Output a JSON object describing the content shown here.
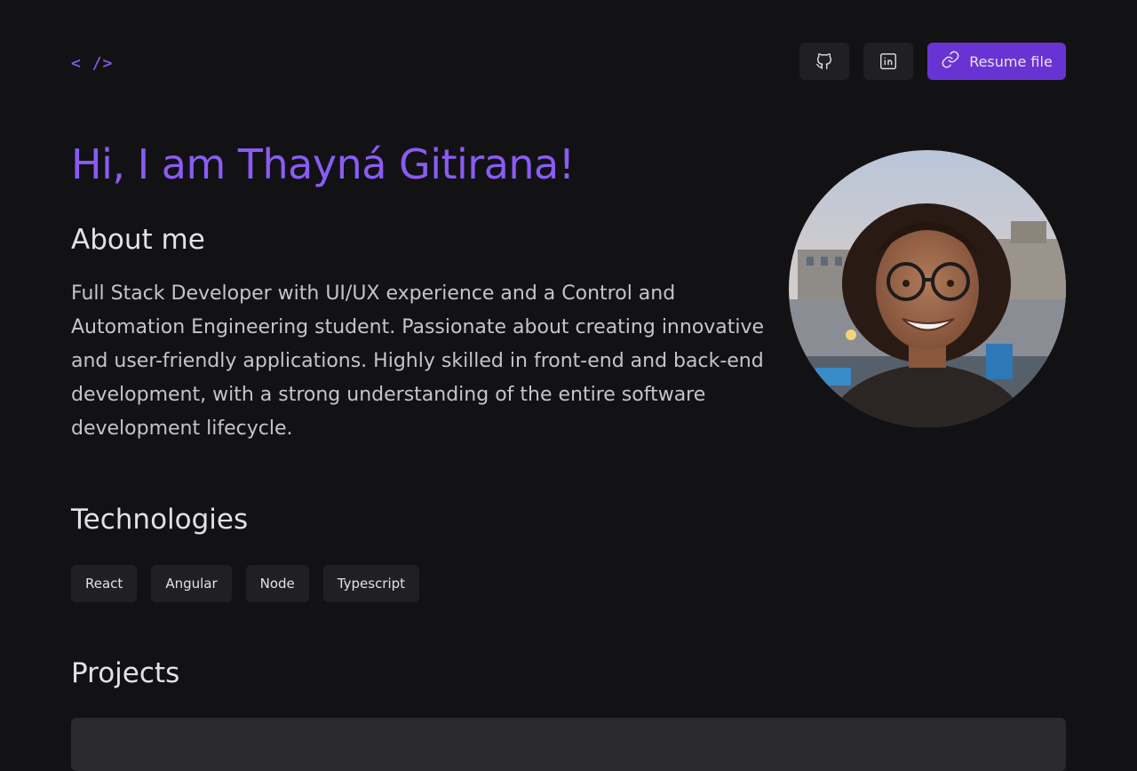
{
  "header": {
    "logo": "< />",
    "github_icon": "github-icon",
    "linkedin_icon": "linkedin-icon",
    "resume_icon": "link-icon",
    "resume_label": "Resume file"
  },
  "hero": {
    "greeting": "Hi, I am Thayná Gitirana!",
    "about_title": "About me",
    "about_text": "Full Stack Developer with UI/UX experience and a Control and Automation Engineering student. Passionate about creating innovative and user-friendly applications. Highly skilled in front-end and back-end development, with a strong understanding of the entire software development lifecycle."
  },
  "technologies": {
    "title": "Technologies",
    "items": [
      "React",
      "Angular",
      "Node",
      "Typescript"
    ]
  },
  "projects": {
    "title": "Projects"
  },
  "colors": {
    "background": "#121214",
    "accent": "#8257e5",
    "button_primary": "#6933d4",
    "surface": "#202024"
  }
}
